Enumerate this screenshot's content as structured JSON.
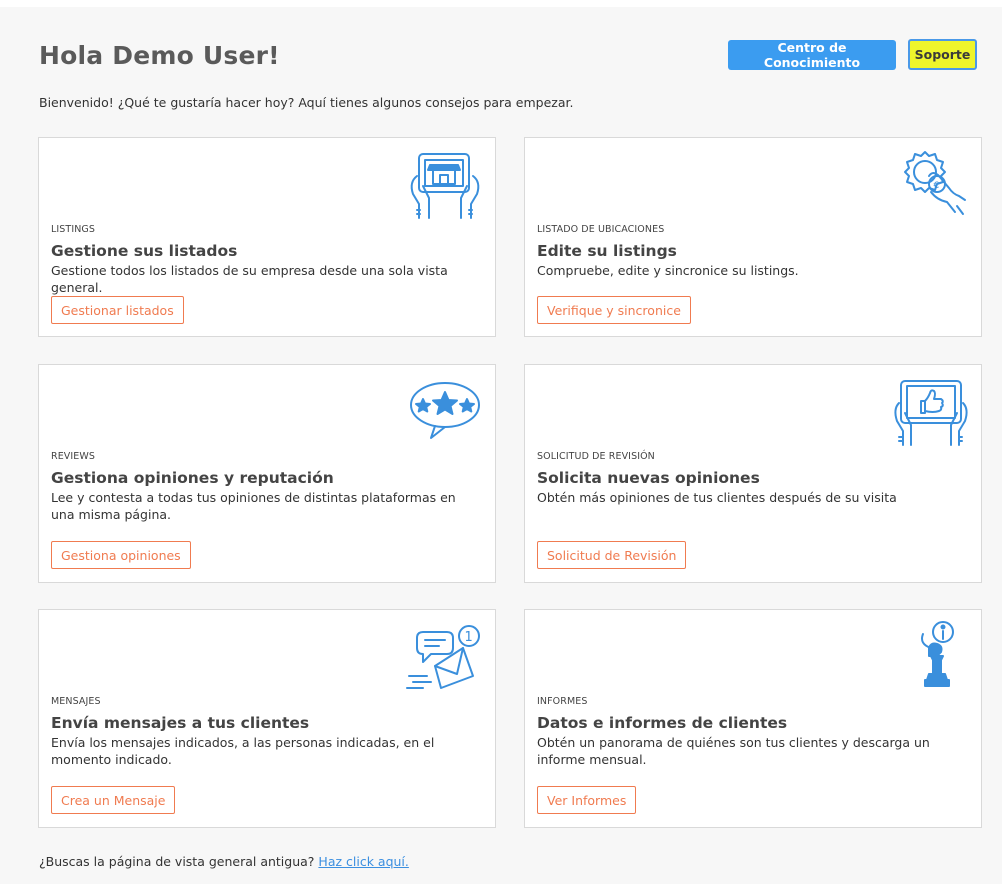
{
  "header": {
    "title": "Hola Demo User!",
    "knowledge_button": "Centro de Conocimiento",
    "support_button": "Soporte"
  },
  "intro": "Bienvenido! ¿Qué te gustaría hacer hoy? Aquí tienes algunos consejos para empezar.",
  "cards": [
    {
      "category": "LISTINGS",
      "title": "Gestione sus listados",
      "description": "Gestione todos los listados de su empresa desde una sola vista general.",
      "button": "Gestionar listados",
      "icon": "tablet-storefront-icon"
    },
    {
      "category": "LISTADO DE UBICACIONES",
      "title": "Edite su listings",
      "description": "Compruebe, edite y sincronice su listings.",
      "button": "Verifique y sincronice",
      "icon": "gear-euro-hand-icon"
    },
    {
      "category": "REVIEWS",
      "title": "Gestiona opiniones y reputación",
      "description": "Lee y contesta a todas tus opiniones de distintas plataformas en una misma página.",
      "button": "Gestiona opiniones",
      "icon": "star-speech-bubble-icon"
    },
    {
      "category": "SOLICITUD DE REVISIÓN",
      "title": "Solicita nuevas opiniones",
      "description": "Obtén más opiniones de tus clientes después de su visita",
      "button": "Solicitud de Revisión",
      "icon": "tablet-thumbs-up-icon"
    },
    {
      "category": "MENSAJES",
      "title": "Envía mensajes a tus clientes",
      "description": "Envía los mensajes indicados, a las personas indicadas, en el momento indicado.",
      "button": "Crea un Mensaje",
      "icon": "message-envelope-icon",
      "badge": "1"
    },
    {
      "category": "INFORMES",
      "title": "Datos e informes de clientes",
      "description": "Obtén un panorama de quiénes son tus clientes y descarga un informe mensual.",
      "button": "Ver Informes",
      "icon": "chess-info-icon"
    }
  ],
  "footer": {
    "text": "¿Buscas la página de vista general antigua?",
    "link": "Haz click aquí."
  },
  "colors": {
    "primary_blue": "#3b9cf0",
    "support_yellow": "#eef52b",
    "action_orange": "#f07b50",
    "icon_blue": "#3a8fdc"
  }
}
